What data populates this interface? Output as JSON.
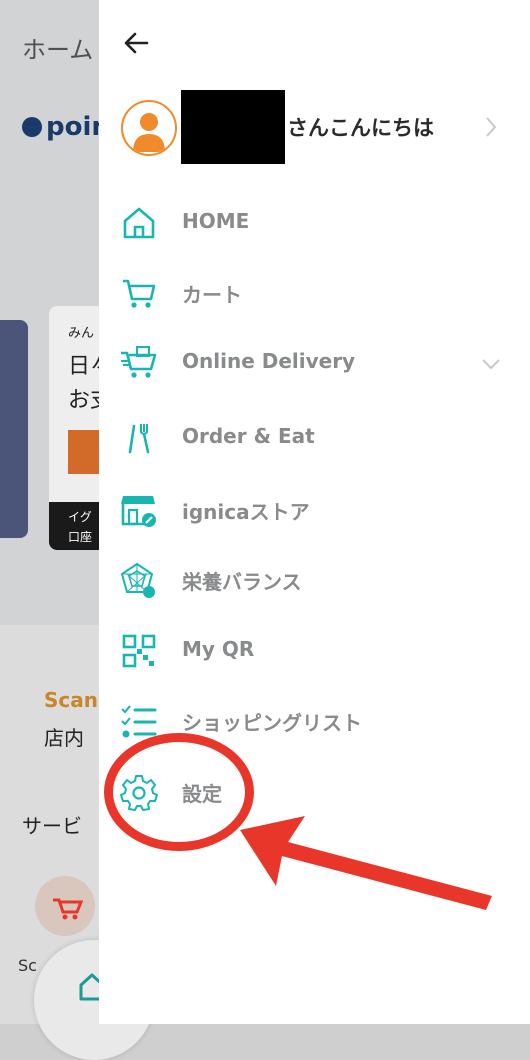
{
  "background": {
    "title": "ホーム",
    "logo": "poin",
    "card_small": "みん",
    "card_line1": "日々",
    "card_line2": "お支",
    "card_bottom1": "イグ",
    "card_bottom2": "口座",
    "scan_label": "Scan",
    "shop_label": "店内",
    "service_label": "サービ",
    "service_item": "Sc"
  },
  "drawer": {
    "greeting": "さんこんにちは",
    "menu": [
      {
        "label": "HOME",
        "icon": "home-icon"
      },
      {
        "label": "カート",
        "icon": "cart-icon"
      },
      {
        "label": "Online Delivery",
        "icon": "delivery-cart-icon",
        "expandable": true
      },
      {
        "label": "Order & Eat",
        "icon": "utensils-icon"
      },
      {
        "label": "ignicaストア",
        "icon": "store-icon"
      },
      {
        "label": "栄養バランス",
        "icon": "nutrition-chart-icon"
      },
      {
        "label": "My QR",
        "icon": "qr-code-icon"
      },
      {
        "label": "ショッピングリスト",
        "icon": "checklist-icon"
      },
      {
        "label": "設定",
        "icon": "gear-icon"
      }
    ]
  },
  "colors": {
    "accent": "#18b6b0",
    "annotation": "#e8362a",
    "avatar": "#f08a2a",
    "label": "#888a8c"
  }
}
